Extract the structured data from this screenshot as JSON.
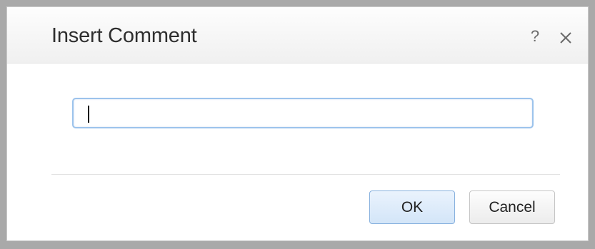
{
  "dialog": {
    "title": "Insert Comment",
    "help_label": "?",
    "close_icon": "close-icon",
    "comment_input": {
      "value": "",
      "placeholder": ""
    },
    "buttons": {
      "ok_label": "OK",
      "cancel_label": "Cancel"
    }
  },
  "colors": {
    "input_focus_border": "#9cc3ec",
    "ok_button_border": "#86b0de",
    "frame_border": "#a9a9a9"
  }
}
